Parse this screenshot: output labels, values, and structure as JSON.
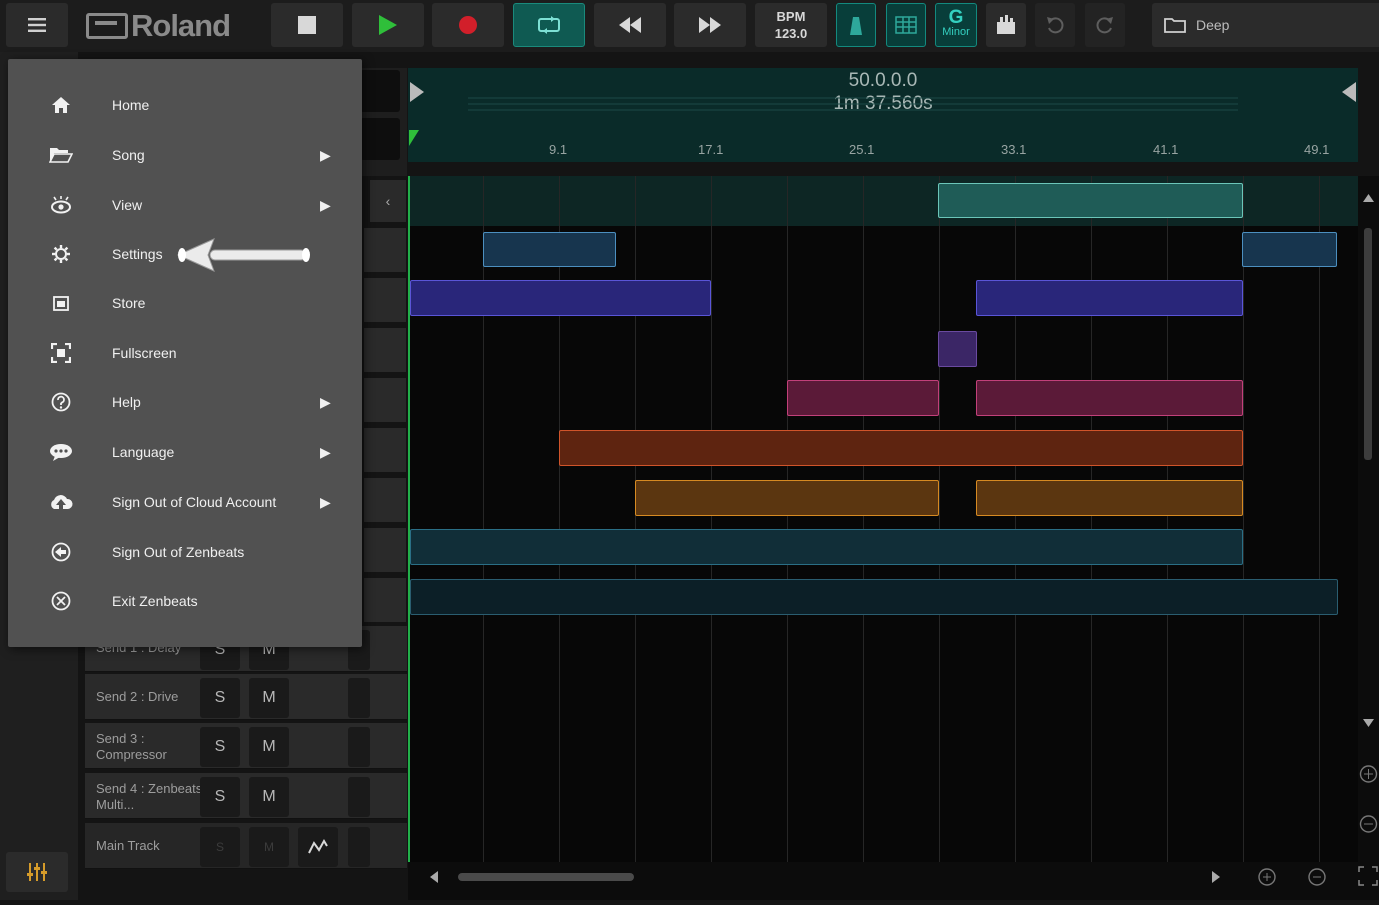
{
  "toolbar": {
    "logo_text": "Roland",
    "bpm_label": "BPM",
    "bpm_value": "123.0",
    "key_note": "G",
    "key_mode": "Minor",
    "project_name": "Deep"
  },
  "timeline": {
    "position": "50.0.0.0",
    "time": "1m 37.560s",
    "bar_markers": [
      "9.1",
      "17.1",
      "25.1",
      "33.1",
      "41.1",
      "49.1"
    ]
  },
  "tracks": [
    {
      "name": "Send 1 : Delay",
      "solo": "S",
      "mute": "M"
    },
    {
      "name": "Send 2 : Drive",
      "solo": "S",
      "mute": "M"
    },
    {
      "name": "Send 3 : Compressor",
      "solo": "S",
      "mute": "M"
    },
    {
      "name": "Send 4 : Zenbeats Multi...",
      "solo": "S",
      "mute": "M"
    },
    {
      "name": "Main Track",
      "solo": "S",
      "mute": "M"
    }
  ],
  "menu": {
    "items": [
      {
        "label": "Home",
        "icon": "home-icon",
        "submenu": false
      },
      {
        "label": "Song",
        "icon": "folder-open-icon",
        "submenu": true
      },
      {
        "label": "View",
        "icon": "eye-icon",
        "submenu": true
      },
      {
        "label": "Settings",
        "icon": "gear-icon",
        "submenu": false
      },
      {
        "label": "Store",
        "icon": "store-icon",
        "submenu": false
      },
      {
        "label": "Fullscreen",
        "icon": "fullscreen-icon",
        "submenu": false
      },
      {
        "label": "Help",
        "icon": "help-icon",
        "submenu": true
      },
      {
        "label": "Language",
        "icon": "speech-bubble-icon",
        "submenu": true
      },
      {
        "label": "Sign Out of Cloud Account",
        "icon": "cloud-icon",
        "submenu": true
      },
      {
        "label": "Sign Out of Zenbeats",
        "icon": "back-circle-icon",
        "submenu": false
      },
      {
        "label": "Exit Zenbeats",
        "icon": "close-circle-icon",
        "submenu": false
      }
    ],
    "submenu_glyph": "▶"
  },
  "colors": {
    "accent_teal": "#138a7f",
    "play_green": "#2fbf3a",
    "record_red": "#d21f2a",
    "clip_blue": "#3f3faf",
    "clip_pink": "#9c2d55",
    "clip_orange": "#b5441d",
    "clip_amber": "#b06a12",
    "clip_cyan": "#2a6f86"
  }
}
